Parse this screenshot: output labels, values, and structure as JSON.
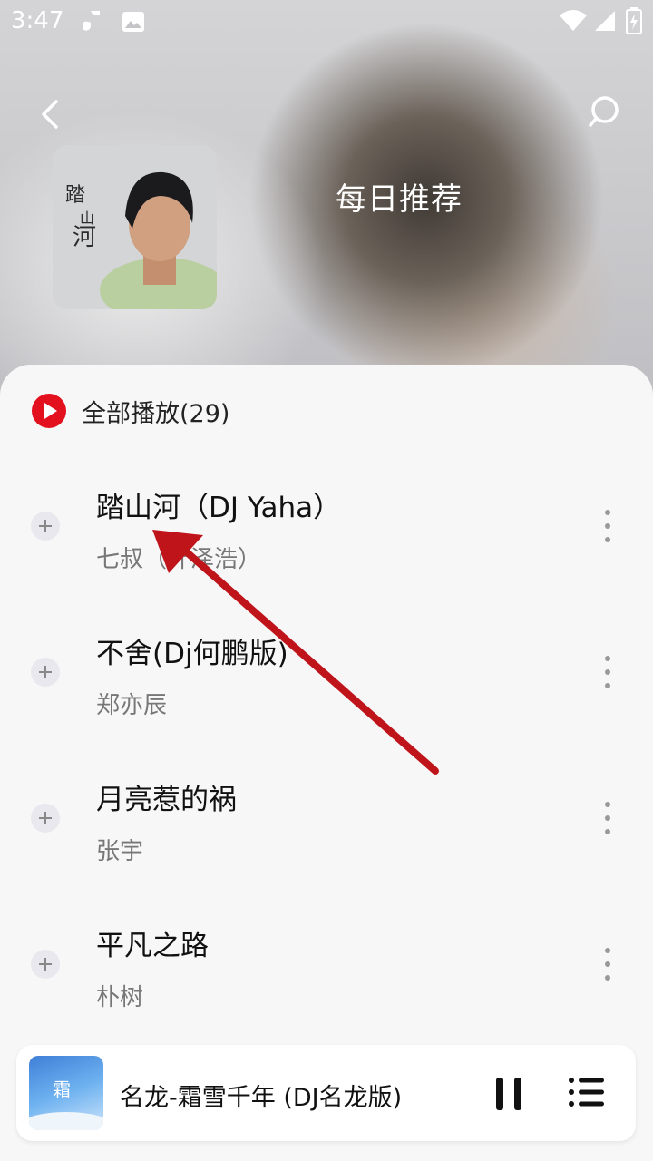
{
  "status_bar": {
    "time": "3:47"
  },
  "header": {
    "title": "每日推荐",
    "cover_alt": "踏山河"
  },
  "play_all": {
    "label": "全部播放(29)"
  },
  "songs": [
    {
      "title": "踏山河（DJ Yaha）",
      "artist": "七叔（叶泽浩）"
    },
    {
      "title": "不舍(Dj何鹏版)",
      "artist": "郑亦辰"
    },
    {
      "title": "月亮惹的祸",
      "artist": "张宇"
    },
    {
      "title": "平凡之路",
      "artist": "朴树"
    }
  ],
  "now_playing": {
    "title": "名龙-霜雪千年 (DJ名龙版)"
  },
  "colors": {
    "accent": "#e3101e",
    "annotation_arrow": "#c0141b"
  },
  "icons": [
    "back-icon",
    "search-icon",
    "play-circle-icon",
    "add-icon",
    "more-icon",
    "pause-icon",
    "queue-icon"
  ]
}
